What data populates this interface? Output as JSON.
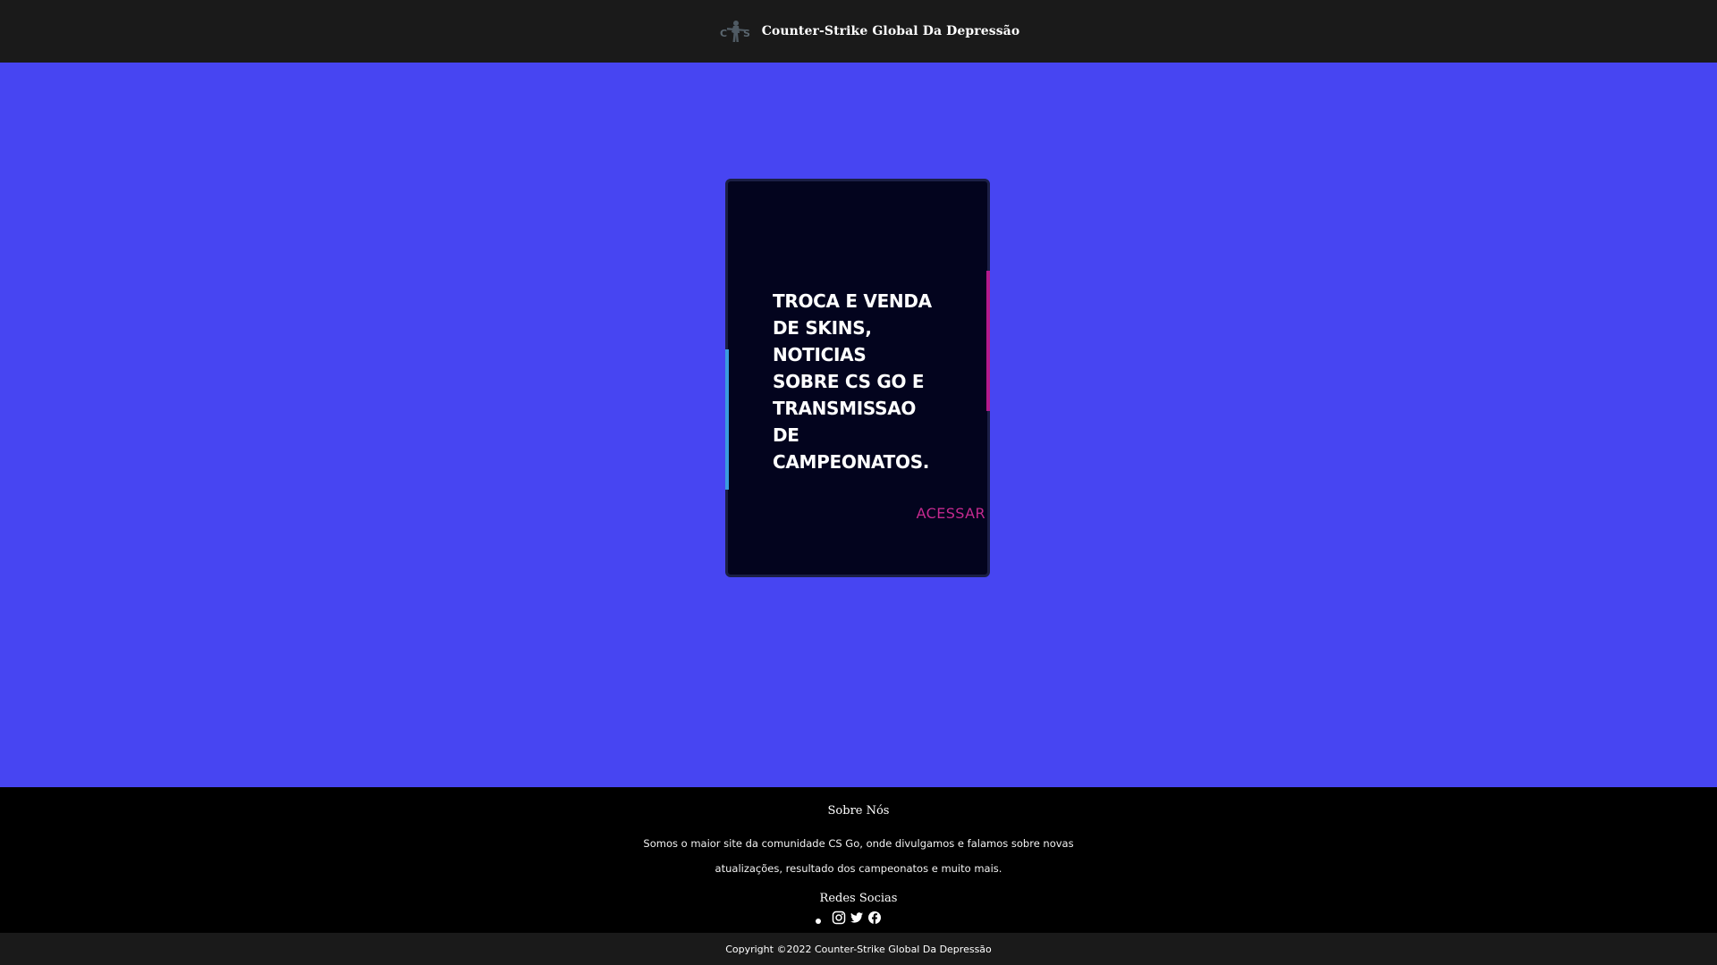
{
  "header": {
    "title": "Counter-Strike Global Da Depressão",
    "logo_icon": "cs-soldier-logo-icon"
  },
  "card": {
    "text": "TROCA E VENDA DE SKINS, NOTICIAS SOBRE CS GO E TRANSMISSAO DE CAMPEONATOS.",
    "link_label": "ACESSAR",
    "accent_left_color": "#3a9be0",
    "accent_right_color": "#b31a8c"
  },
  "footer": {
    "about_title": "Sobre Nós",
    "about_text": "Somos o maior site da comunidade CS Go, onde divulgamos e falamos sobre novas atualizações, resultado dos campeonatos e muito mais.",
    "social_title": "Redes Socias",
    "social_icons": [
      "instagram-icon",
      "twitter-icon",
      "facebook-icon"
    ]
  },
  "copyright": {
    "text": "Copyright ©2022 Counter-Strike Global Da Depressão"
  },
  "colors": {
    "background": "#4745f2",
    "header": "#1a1a1a",
    "card": "#03041e",
    "accent_link": "#c42a8f"
  }
}
